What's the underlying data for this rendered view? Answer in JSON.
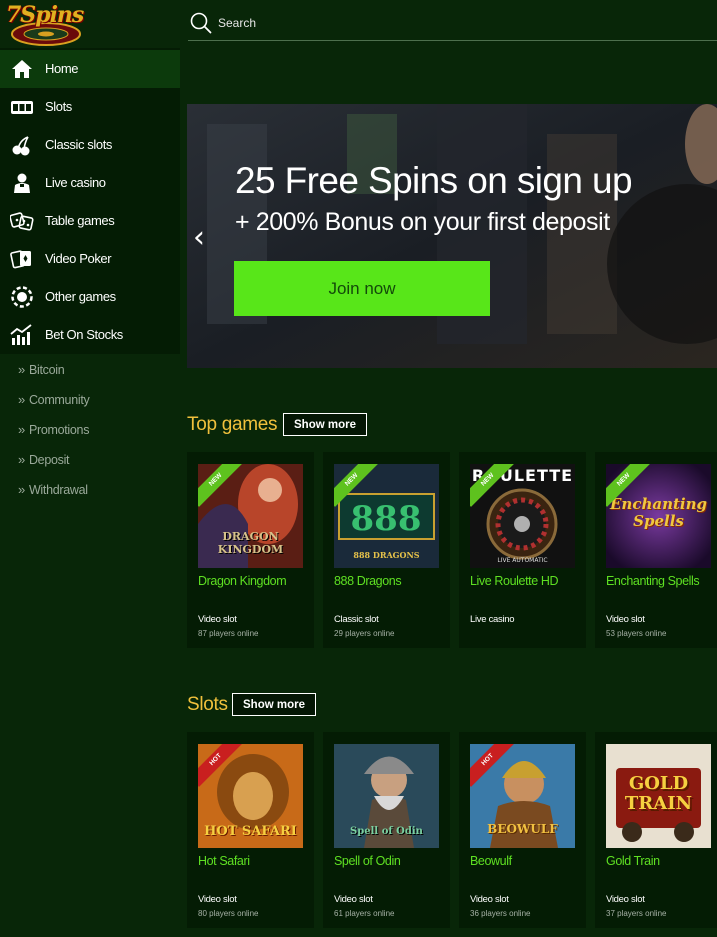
{
  "logo": {
    "text": "7Spins"
  },
  "search": {
    "placeholder": "Search"
  },
  "sidebar": {
    "items": [
      {
        "label": "Home",
        "icon": "home-icon"
      },
      {
        "label": "Slots",
        "icon": "slots-icon"
      },
      {
        "label": "Classic slots",
        "icon": "cherry-icon"
      },
      {
        "label": "Live casino",
        "icon": "dealer-icon"
      },
      {
        "label": "Table games",
        "icon": "dice-icon"
      },
      {
        "label": "Video Poker",
        "icon": "cards-icon"
      },
      {
        "label": "Other games",
        "icon": "chip-icon"
      },
      {
        "label": "Bet On Stocks",
        "icon": "stocks-chart-icon"
      }
    ],
    "sub_items": [
      {
        "label": "Bitcoin"
      },
      {
        "label": "Community"
      },
      {
        "label": "Promotions"
      },
      {
        "label": "Deposit"
      },
      {
        "label": "Withdrawal"
      }
    ]
  },
  "banner": {
    "headline": "25 Free Spins on sign up",
    "subline": "+ 200% Bonus on your first deposit",
    "cta": "Join now"
  },
  "top_games": {
    "title": "Top games",
    "show_more": "Show more",
    "cards": [
      {
        "name": "Dragon Kingdom",
        "type": "Video slot",
        "online": "87 players online",
        "badge": "NEW",
        "art_text": "DRAGON KINGDOM"
      },
      {
        "name": "888 Dragons",
        "type": "Classic slot",
        "online": "29 players online",
        "badge": "NEW",
        "art_text": "888 DRAGONS"
      },
      {
        "name": "Live Roulette HD",
        "type": "Live casino",
        "online": "",
        "badge": "NEW",
        "art_text": "ROULETTE",
        "art_sub": "LIVE AUTOMATIC"
      },
      {
        "name": "Enchanting Spells",
        "type": "Video slot",
        "online": "53 players online",
        "badge": "NEW",
        "art_text": "Enchanting Spells"
      }
    ]
  },
  "slots": {
    "title": "Slots",
    "show_more": "Show more",
    "cards": [
      {
        "name": "Hot Safari",
        "type": "Video slot",
        "online": "80 players online",
        "badge": "HOT",
        "art_text": "HOT SAFARI"
      },
      {
        "name": "Spell of Odin",
        "type": "Video slot",
        "online": "61 players online",
        "badge": "",
        "art_text": "Spell of Odin"
      },
      {
        "name": "Beowulf",
        "type": "Video slot",
        "online": "36 players online",
        "badge": "HOT",
        "art_text": "BEOWULF"
      },
      {
        "name": "Gold Train",
        "type": "Video slot",
        "online": "37 players online",
        "badge": "",
        "art_text": "GOLD TRAIN"
      }
    ]
  },
  "colors": {
    "background": "#082608",
    "sidebar": "#041c04",
    "accent_green": "#58e619",
    "game_name": "#5ee022",
    "section_title": "#f0c03c"
  }
}
